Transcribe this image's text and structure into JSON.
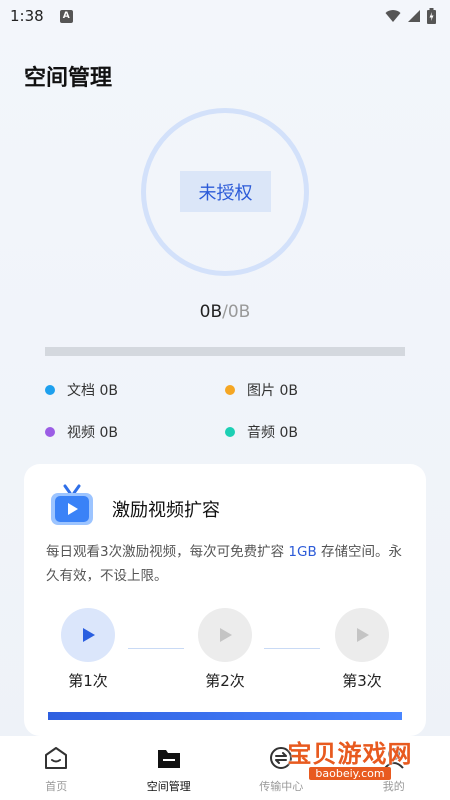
{
  "status_bar": {
    "time": "1:38",
    "notification_letter": "A"
  },
  "page": {
    "title": "空间管理"
  },
  "storage": {
    "status": "未授权",
    "used": "0B",
    "separator": "/",
    "total": "0B",
    "progress_fraction": 0
  },
  "legend": [
    {
      "label": "文档 0B",
      "color": "#1ea0ee"
    },
    {
      "label": "图片 0B",
      "color": "#f5a623"
    },
    {
      "label": "视频 0B",
      "color": "#9b5de5"
    },
    {
      "label": "音频 0B",
      "color": "#1ccfb4"
    }
  ],
  "reward_card": {
    "icon": "tv-video-icon",
    "title": "激励视频扩容",
    "desc_before": "每日观看3次激励视频，每次可免费扩容 ",
    "desc_highlight": "1GB",
    "desc_after": " 存储空间。永久有效，不设上限。",
    "steps": [
      "第1次",
      "第2次",
      "第3次"
    ]
  },
  "nav": {
    "items": [
      {
        "label": "首页",
        "icon": "home-icon"
      },
      {
        "label": "空间管理",
        "icon": "folder-icon"
      },
      {
        "label": "传输中心",
        "icon": "transfer-icon"
      },
      {
        "label": "我的",
        "icon": "profile-icon"
      }
    ]
  },
  "watermark": {
    "text": "宝贝游戏网",
    "url": "baobeiy.com"
  }
}
